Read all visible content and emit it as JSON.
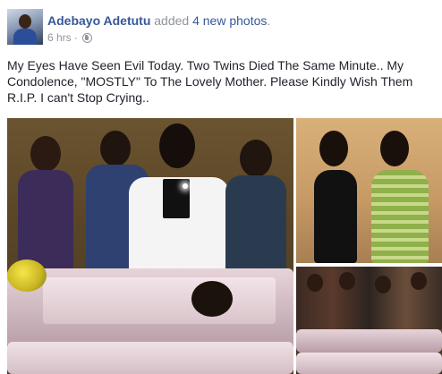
{
  "post": {
    "author": "Adebayo Adetutu",
    "action_prefix": " added ",
    "action_link": "4 new photos",
    "action_suffix": ".",
    "time": "6 hrs",
    "separator": "·",
    "privacy_icon": "globe-icon",
    "text": "My Eyes Have Seen Evil Today. Two Twins Died The Same Minute.. My Condolence, \"MOSTLY\" To The Lovely Mother. Please Kindly Wish Them R.I.P. I can't Stop Crying.."
  },
  "photos": {
    "count": 3
  },
  "colors": {
    "link": "#365899",
    "secondary_text": "#90949c",
    "body_text": "#1d2129"
  }
}
